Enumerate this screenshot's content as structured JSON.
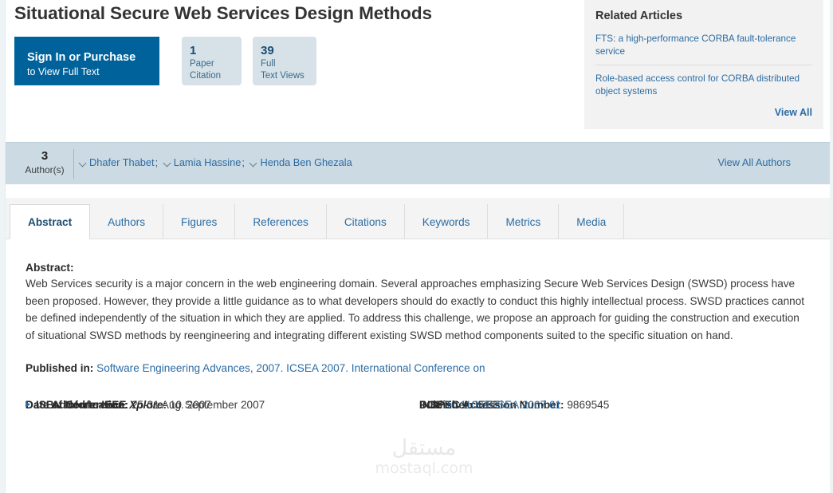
{
  "document": {
    "title": "Situational Secure Web Services Design Methods"
  },
  "actions": {
    "signin_line1": "Sign In or Purchase",
    "signin_line2": "to View Full Text"
  },
  "metrics": [
    {
      "number": "1",
      "label_line1": "Paper",
      "label_line2": "Citation"
    },
    {
      "number": "39",
      "label_line1": "Full",
      "label_line2": "Text Views"
    }
  ],
  "related_articles": {
    "title": "Related Articles",
    "items": [
      "FTS: a high-performance CORBA fault-tolerance service",
      "Role-based access control for CORBA distributed object systems"
    ],
    "view_all_label": "View All"
  },
  "authors": {
    "count": "3",
    "count_label": "Author(s)",
    "names": [
      "Dhafer Thabet",
      "Lamia Hassine",
      "Henda Ben Ghezala"
    ],
    "separator": ";",
    "view_all_label": "View All Authors"
  },
  "tabs": [
    {
      "label": "Abstract",
      "active": true
    },
    {
      "label": "Authors",
      "active": false
    },
    {
      "label": "Figures",
      "active": false
    },
    {
      "label": "References",
      "active": false
    },
    {
      "label": "Citations",
      "active": false
    },
    {
      "label": "Keywords",
      "active": false
    },
    {
      "label": "Metrics",
      "active": false
    },
    {
      "label": "Media",
      "active": false
    }
  ],
  "abstract": {
    "heading": "Abstract:",
    "body": "Web Services security is a major concern in the web engineering domain. Several approaches emphasizing Secure Web Services Design (SWSD) process have been proposed. However, they provide a little guidance as to what developers should do exactly to conduct this highly intellectual process. SWSD practices cannot be defined independently of the situation in which they are applied. To address this challenge, we propose an approach for guiding the construction and execution of situational SWSD methods by reengineering and integrating different existing SWSD method components suited to the specific situation on hand."
  },
  "published_in": {
    "key": "Published in:",
    "value": "Software Engineering Advances, 2007. ICSEA 2007. International Conference on"
  },
  "metadata": {
    "date_of_conference": {
      "key": "Date of Conference:",
      "value": "25-31 Aug. 2007"
    },
    "date_added": {
      "key_pre": "Date Added to IEEE ",
      "key_em": "Xplore",
      "key_post": ":",
      "value": "10 September 2007"
    },
    "isbn_information": {
      "key": "ISBN Information:"
    },
    "inspec": {
      "key": "INSPEC Accession Number:",
      "value": "9869545"
    },
    "doi": {
      "key": "DOI:",
      "value": "10.1109/ICSEA.2007.61"
    },
    "publisher": {
      "key": "Publisher:",
      "value": "IEEE"
    }
  },
  "watermark": {
    "arabic": "مستقل",
    "domain": "mostaql.com"
  },
  "colors": {
    "accent_blue": "#00629b",
    "link_blue": "#2b6ca3",
    "authors_bar": "#ccdae3",
    "metric_box": "#d6e1e8",
    "panel_gray": "#f2f2f2"
  }
}
